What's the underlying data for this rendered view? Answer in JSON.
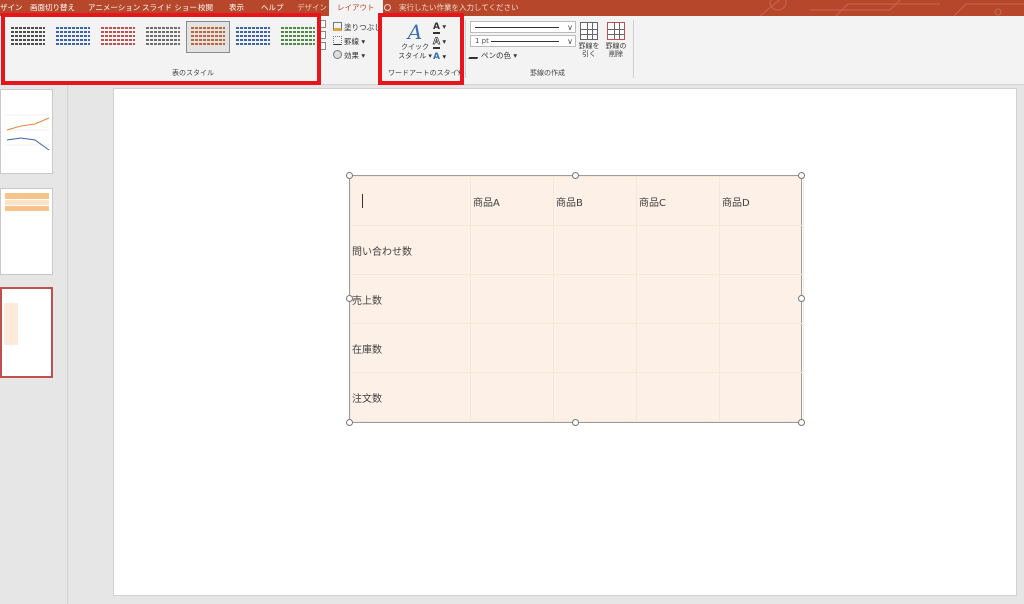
{
  "tabs": [
    {
      "label": "ザイン"
    },
    {
      "label": "画面切り替え"
    },
    {
      "label": "アニメーション"
    },
    {
      "label": "スライド ショー"
    },
    {
      "label": "校閲"
    },
    {
      "label": "表示"
    },
    {
      "label": "ヘルプ"
    },
    {
      "label": "デザイン"
    },
    {
      "label": "レイアウト"
    }
  ],
  "tell_me": "実行したい作業を入力してください",
  "ribbon": {
    "table_styles": {
      "label": "表のスタイル",
      "swatch_colors": [
        "#4d4d4d",
        "#3f63a8",
        "#c0504d",
        "#6e6e6e",
        "#c0643c",
        "#3f63a8",
        "#4f8a44"
      ],
      "selected_index": 4
    },
    "fill_label": "塗りつぶし",
    "border_label": "罫線",
    "effect_label": "効果",
    "quick_style_label": "クイック",
    "quick_style_label2": "スタイル",
    "wordart_label": "ワードアートのスタイル",
    "pen_weight": "1 pt",
    "pen_color_label": "ペンの色",
    "draw_table_label": "罫線を",
    "draw_table_label2": "引く",
    "eraser_label": "罫線の",
    "eraser_label2": "削除",
    "draw_borders_label": "罫線の作成"
  },
  "table": {
    "headers": [
      "",
      "商品A",
      "商品B",
      "商品C",
      "商品D"
    ],
    "rows": [
      {
        "label": "問い合わせ数"
      },
      {
        "label": "売上数"
      },
      {
        "label": "在庫数"
      },
      {
        "label": "注文数"
      }
    ]
  },
  "colors": {
    "accent": "#b7472a",
    "highlight_box": "#e8141c",
    "table_fill": "#fdf1e7"
  }
}
